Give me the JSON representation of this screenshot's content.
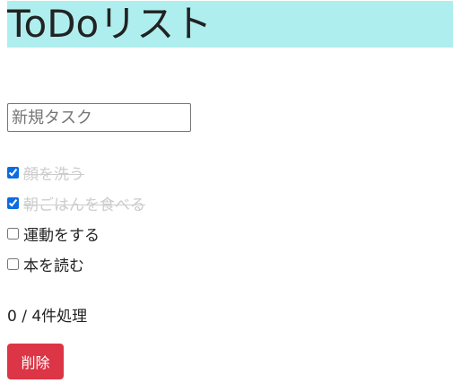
{
  "header": {
    "title": "ToDoリスト",
    "background": "#afeeee"
  },
  "new_task": {
    "placeholder": "新規タスク",
    "value": ""
  },
  "todos": [
    {
      "label": "顔を洗う",
      "checked": true
    },
    {
      "label": "朝ごはんを食べる",
      "checked": true
    },
    {
      "label": "運動をする",
      "checked": false
    },
    {
      "label": "本を読む",
      "checked": false
    }
  ],
  "status": {
    "text": "0 / 4件処理"
  },
  "delete_button": {
    "label": "削除",
    "color": "#dc3545"
  }
}
